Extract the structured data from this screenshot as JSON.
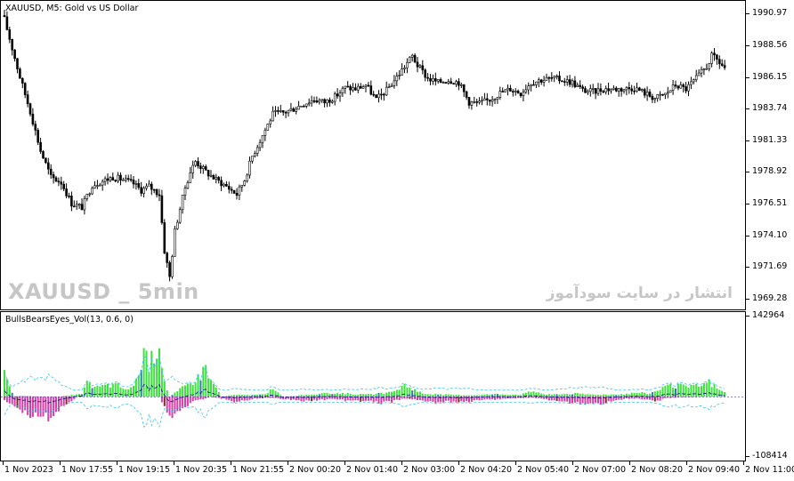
{
  "main_chart": {
    "title": "XAUUSD, M5:  Gold vs US Dollar",
    "symbol_watermark": "XAUUSD _ 5min",
    "site_watermark": "انتشار در سایت سودآموز",
    "price_axis_labels": [
      "1990.97",
      "1988.56",
      "1986.15",
      "1983.74",
      "1981.33",
      "1978.92",
      "1976.51",
      "1974.10",
      "1971.69",
      "1969.28"
    ],
    "colors": {
      "candle": "#000000",
      "background": "#ffffff"
    }
  },
  "indicator": {
    "title": "BullsBearsEyes_Vol(13, 0.6, 0)",
    "axis_labels": [
      "142964",
      "-108414"
    ],
    "colors": {
      "bull": "#3de23d",
      "bear": "#d63fa6",
      "bull_dark": "#2a7fa6",
      "bear_dark": "#7a2a2a",
      "band": "#3fc4f0",
      "signal": "#1a1a8c"
    }
  },
  "time_axis": {
    "labels": [
      "1 Nov 2023",
      "1 Nov 17:55",
      "1 Nov 19:15",
      "1 Nov 20:35",
      "1 Nov 21:55",
      "2 Nov 00:20",
      "2 Nov 01:40",
      "2 Nov 03:00",
      "2 Nov 04:20",
      "2 Nov 05:40",
      "2 Nov 07:00",
      "2 Nov 08:20",
      "2 Nov 09:40",
      "2 Nov 11:00"
    ]
  },
  "chart_data": [
    {
      "type": "candlestick",
      "title": "XAUUSD, M5:  Gold vs US Dollar",
      "xlabel": "",
      "ylabel": "",
      "ylim": [
        1968.4,
        1992.0
      ],
      "y_ticks": [
        1990.97,
        1988.56,
        1986.15,
        1983.74,
        1981.33,
        1978.92,
        1976.51,
        1974.1,
        1971.69,
        1969.28
      ],
      "x_ticks": [
        "1 Nov 2023",
        "1 Nov 17:55",
        "1 Nov 19:15",
        "1 Nov 20:35",
        "1 Nov 21:55",
        "2 Nov 00:20",
        "2 Nov 01:40",
        "2 Nov 03:00",
        "2 Nov 04:20",
        "2 Nov 05:40",
        "2 Nov 07:00",
        "2 Nov 08:20",
        "2 Nov 09:40",
        "2 Nov 11:00"
      ],
      "close_path": [
        [
          0,
          1990.6
        ],
        [
          3,
          1988.4
        ],
        [
          6,
          1986.2
        ],
        [
          10,
          1983.6
        ],
        [
          14,
          1980.6
        ],
        [
          18,
          1978.6
        ],
        [
          22,
          1978.2
        ],
        [
          26,
          1976.6
        ],
        [
          30,
          1976.3
        ],
        [
          34,
          1978.0
        ],
        [
          38,
          1978.3
        ],
        [
          42,
          1978.6
        ],
        [
          46,
          1978.4
        ],
        [
          50,
          1978.1
        ],
        [
          53,
          1977.6
        ],
        [
          56,
          1977.9
        ],
        [
          60,
          1977.3
        ],
        [
          62,
          1973.0
        ],
        [
          64,
          1971.0
        ],
        [
          66,
          1974.5
        ],
        [
          68,
          1976.2
        ],
        [
          70,
          1977.8
        ],
        [
          72,
          1979.0
        ],
        [
          74,
          1979.8
        ],
        [
          78,
          1979.0
        ],
        [
          82,
          1978.4
        ],
        [
          86,
          1977.9
        ],
        [
          90,
          1977.3
        ],
        [
          93,
          1978.4
        ],
        [
          96,
          1980.2
        ],
        [
          100,
          1981.8
        ],
        [
          104,
          1983.4
        ],
        [
          108,
          1983.5
        ],
        [
          112,
          1983.8
        ],
        [
          116,
          1984.2
        ],
        [
          120,
          1984.5
        ],
        [
          124,
          1984.3
        ],
        [
          128,
          1984.7
        ],
        [
          132,
          1985.4
        ],
        [
          136,
          1985.3
        ],
        [
          140,
          1985.6
        ],
        [
          144,
          1984.5
        ],
        [
          148,
          1985.2
        ],
        [
          152,
          1986.2
        ],
        [
          156,
          1987.3
        ],
        [
          158,
          1987.8
        ],
        [
          160,
          1987.1
        ],
        [
          164,
          1986.1
        ],
        [
          168,
          1985.8
        ],
        [
          172,
          1986.0
        ],
        [
          176,
          1985.8
        ],
        [
          180,
          1984.3
        ],
        [
          184,
          1984.2
        ],
        [
          188,
          1984.5
        ],
        [
          192,
          1985.0
        ],
        [
          196,
          1985.3
        ],
        [
          200,
          1985.0
        ],
        [
          204,
          1985.8
        ],
        [
          208,
          1986.0
        ],
        [
          212,
          1986.1
        ],
        [
          216,
          1986.0
        ],
        [
          220,
          1985.8
        ],
        [
          224,
          1985.2
        ],
        [
          228,
          1985.1
        ],
        [
          232,
          1985.3
        ],
        [
          236,
          1985.3
        ],
        [
          240,
          1985.3
        ],
        [
          244,
          1985.4
        ],
        [
          248,
          1985.0
        ],
        [
          252,
          1984.6
        ],
        [
          256,
          1984.9
        ],
        [
          260,
          1985.6
        ],
        [
          264,
          1985.3
        ],
        [
          268,
          1986.1
        ],
        [
          272,
          1987.0
        ],
        [
          274,
          1987.8
        ],
        [
          276,
          1987.5
        ],
        [
          279,
          1986.9
        ]
      ],
      "series": [
        {
          "name": "",
          "color": "#000000"
        }
      ]
    },
    {
      "type": "histogram",
      "title": "BullsBearsEyes_Vol(13, 0.6, 0)",
      "ylim": [
        -108414,
        142964
      ],
      "series": [
        {
          "name": "bull",
          "color": "#3de23d",
          "values_path": [
            [
              0,
              42000
            ],
            [
              2,
              16000
            ],
            [
              4,
              2000
            ],
            [
              20,
              0
            ],
            [
              30,
              5000
            ],
            [
              32,
              24000
            ],
            [
              36,
              18000
            ],
            [
              40,
              22000
            ],
            [
              44,
              22000
            ],
            [
              48,
              12000
            ],
            [
              52,
              40000
            ],
            [
              54,
              80000
            ],
            [
              56,
              60000
            ],
            [
              60,
              105000
            ],
            [
              62,
              30000
            ],
            [
              64,
              0
            ],
            [
              76,
              40000
            ],
            [
              78,
              62000
            ],
            [
              80,
              28000
            ],
            [
              82,
              18000
            ],
            [
              84,
              0
            ],
            [
              88,
              3000
            ],
            [
              100,
              4000
            ],
            [
              104,
              14000
            ],
            [
              108,
              0
            ],
            [
              120,
              5000
            ],
            [
              130,
              7000
            ],
            [
              140,
              4000
            ],
            [
              150,
              8000
            ],
            [
              155,
              22000
            ],
            [
              158,
              16000
            ],
            [
              162,
              6000
            ],
            [
              170,
              4000
            ],
            [
              180,
              3000
            ],
            [
              190,
              5000
            ],
            [
              200,
              4000
            ],
            [
              205,
              11000
            ],
            [
              210,
              4000
            ],
            [
              220,
              6000
            ],
            [
              230,
              4000
            ],
            [
              240,
              5000
            ],
            [
              245,
              8000
            ],
            [
              250,
              6000
            ],
            [
              255,
              18000
            ],
            [
              260,
              21000
            ],
            [
              265,
              18000
            ],
            [
              270,
              22000
            ],
            [
              273,
              28000
            ],
            [
              276,
              16000
            ],
            [
              279,
              8000
            ]
          ]
        },
        {
          "name": "bear",
          "color": "#d63fa6",
          "values_path": [
            [
              0,
              -6000
            ],
            [
              4,
              -15000
            ],
            [
              8,
              -30000
            ],
            [
              12,
              -36000
            ],
            [
              16,
              -40000
            ],
            [
              20,
              -30000
            ],
            [
              24,
              -18000
            ],
            [
              26,
              -8000
            ],
            [
              28,
              0
            ],
            [
              60,
              0
            ],
            [
              62,
              -18000
            ],
            [
              64,
              -32000
            ],
            [
              66,
              -38000
            ],
            [
              68,
              -28000
            ],
            [
              70,
              -20000
            ],
            [
              72,
              -12000
            ],
            [
              76,
              -6000
            ],
            [
              80,
              0
            ],
            [
              86,
              -5000
            ],
            [
              90,
              -10000
            ],
            [
              94,
              -6000
            ],
            [
              98,
              -3000
            ],
            [
              104,
              -2000
            ],
            [
              110,
              -5000
            ],
            [
              116,
              -8000
            ],
            [
              122,
              -6000
            ],
            [
              128,
              -4000
            ],
            [
              134,
              -9000
            ],
            [
              140,
              -7000
            ],
            [
              146,
              -12000
            ],
            [
              150,
              -9000
            ],
            [
              154,
              -4000
            ],
            [
              160,
              -5000
            ],
            [
              166,
              -10000
            ],
            [
              172,
              -8000
            ],
            [
              176,
              -12000
            ],
            [
              180,
              -9000
            ],
            [
              186,
              -6000
            ],
            [
              192,
              -4000
            ],
            [
              198,
              -3000
            ],
            [
              204,
              -2000
            ],
            [
              210,
              -5000
            ],
            [
              216,
              -10000
            ],
            [
              222,
              -12000
            ],
            [
              226,
              -16000
            ],
            [
              230,
              -14000
            ],
            [
              234,
              -8000
            ],
            [
              240,
              -4000
            ],
            [
              246,
              -3000
            ],
            [
              252,
              -9000
            ],
            [
              256,
              -3000
            ],
            [
              262,
              -1000
            ],
            [
              279,
              0
            ]
          ]
        }
      ]
    }
  ]
}
